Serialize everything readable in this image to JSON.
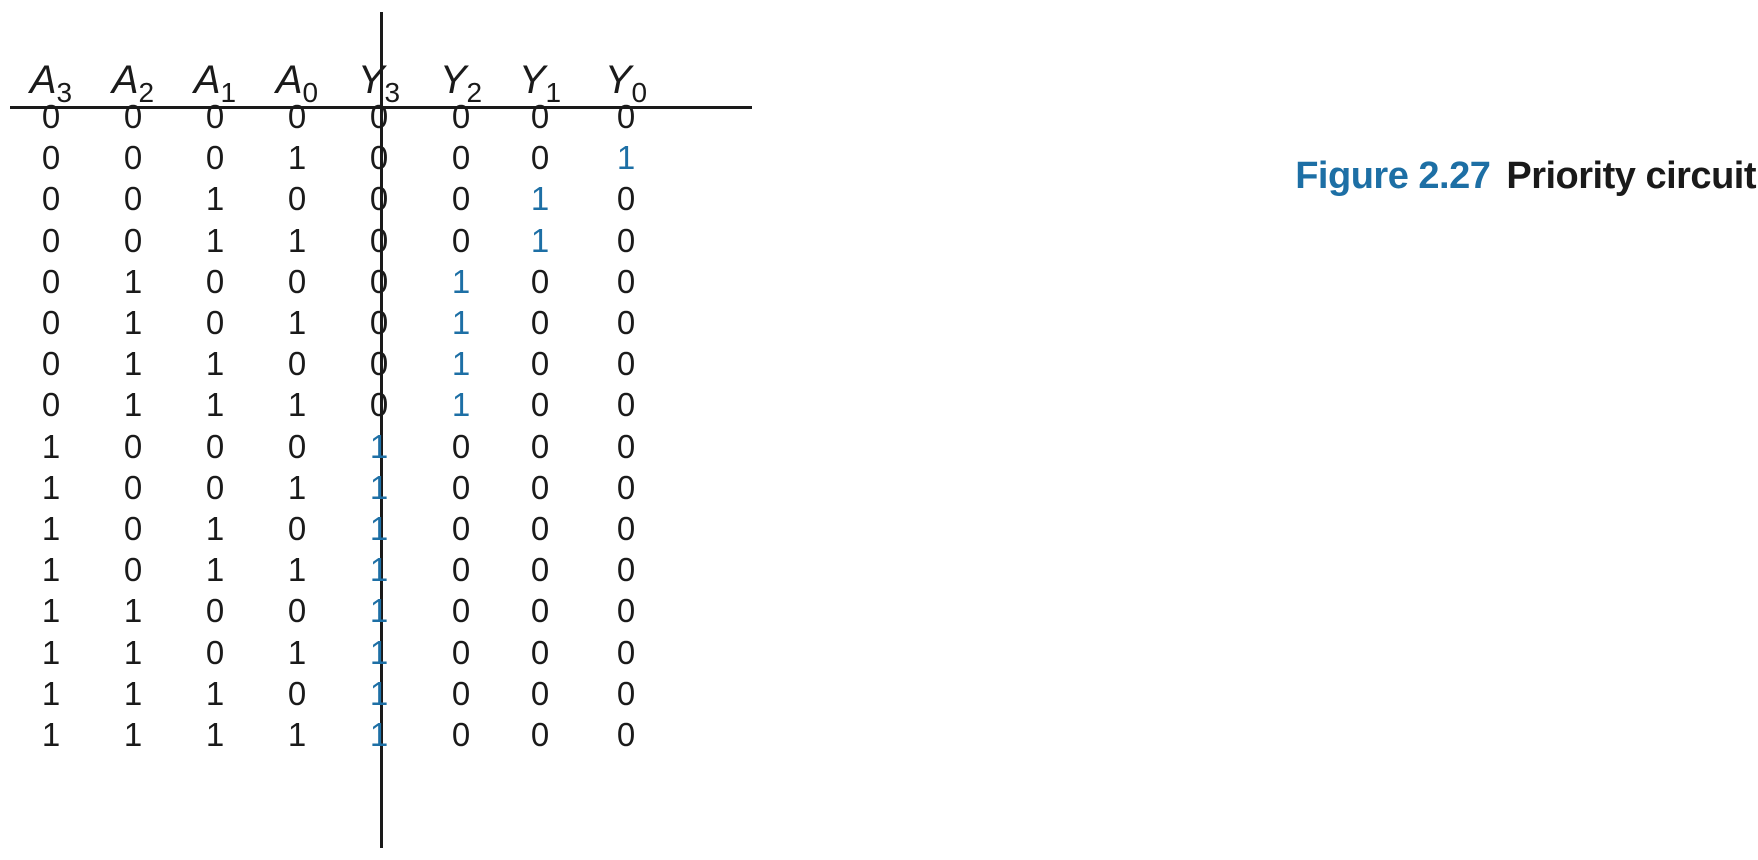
{
  "figure": {
    "number": "Figure 2.27",
    "title": "Priority circuit"
  },
  "table": {
    "headers": [
      {
        "letter": "A",
        "sub": "3"
      },
      {
        "letter": "A",
        "sub": "2"
      },
      {
        "letter": "A",
        "sub": "1"
      },
      {
        "letter": "A",
        "sub": "0"
      },
      {
        "letter": "Y",
        "sub": "3"
      },
      {
        "letter": "Y",
        "sub": "2"
      },
      {
        "letter": "Y",
        "sub": "1"
      },
      {
        "letter": "Y",
        "sub": "0"
      }
    ],
    "rows": [
      [
        "0",
        "0",
        "0",
        "0",
        "0",
        "0",
        "0",
        "0"
      ],
      [
        "0",
        "0",
        "0",
        "1",
        "0",
        "0",
        "0",
        "1"
      ],
      [
        "0",
        "0",
        "1",
        "0",
        "0",
        "0",
        "1",
        "0"
      ],
      [
        "0",
        "0",
        "1",
        "1",
        "0",
        "0",
        "1",
        "0"
      ],
      [
        "0",
        "1",
        "0",
        "0",
        "0",
        "1",
        "0",
        "0"
      ],
      [
        "0",
        "1",
        "0",
        "1",
        "0",
        "1",
        "0",
        "0"
      ],
      [
        "0",
        "1",
        "1",
        "0",
        "0",
        "1",
        "0",
        "0"
      ],
      [
        "0",
        "1",
        "1",
        "1",
        "0",
        "1",
        "0",
        "0"
      ],
      [
        "1",
        "0",
        "0",
        "0",
        "1",
        "0",
        "0",
        "0"
      ],
      [
        "1",
        "0",
        "0",
        "1",
        "1",
        "0",
        "0",
        "0"
      ],
      [
        "1",
        "0",
        "1",
        "0",
        "1",
        "0",
        "0",
        "0"
      ],
      [
        "1",
        "0",
        "1",
        "1",
        "1",
        "0",
        "0",
        "0"
      ],
      [
        "1",
        "1",
        "0",
        "0",
        "1",
        "0",
        "0",
        "0"
      ],
      [
        "1",
        "1",
        "0",
        "1",
        "1",
        "0",
        "0",
        "0"
      ],
      [
        "1",
        "1",
        "1",
        "0",
        "1",
        "0",
        "0",
        "0"
      ],
      [
        "1",
        "1",
        "1",
        "1",
        "1",
        "0",
        "0",
        "0"
      ]
    ],
    "highlight_color": "#1d6fa5",
    "text_color": "#1a1a1a"
  }
}
